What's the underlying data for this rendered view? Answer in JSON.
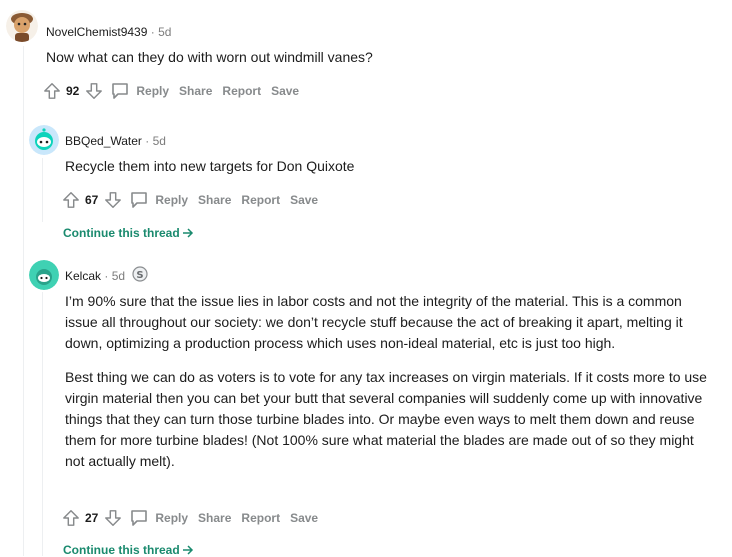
{
  "comments": [
    {
      "username": "NovelChemist9439",
      "age": "5d",
      "text": [
        "Now what can they do with worn out windmill vanes?"
      ],
      "votes": "92",
      "actions": {
        "reply": "Reply",
        "share": "Share",
        "report": "Report",
        "save": "Save"
      }
    },
    {
      "username": "BBQed_Water",
      "age": "5d",
      "text": [
        "Recycle them into new targets for Don Quixote"
      ],
      "votes": "67",
      "actions": {
        "reply": "Reply",
        "share": "Share",
        "report": "Report",
        "save": "Save"
      },
      "continue_label": "Continue this thread"
    },
    {
      "username": "Kelcak",
      "age": "5d",
      "award": "silver-award-icon",
      "text": [
        "I’m 90% sure that the issue lies in labor costs and not the integrity of the material. This is a common issue all throughout our society: we don’t recycle stuff because the act of breaking it apart, melting it down, optimizing a production process which uses non-ideal material, etc is just too high.",
        "Best thing we can do as voters is to vote for any tax increases on virgin materials. If it costs more to use virgin material then you can bet your butt that several companies will suddenly come up with innovative things that they can turn those turbine blades into. Or maybe even ways to melt them down and reuse them for more turbine blades! (Not 100% sure what material the blades are made out of so they might not actually melt)."
      ],
      "votes": "27",
      "actions": {
        "reply": "Reply",
        "share": "Share",
        "report": "Report",
        "save": "Save"
      },
      "continue_label": "Continue this thread"
    }
  ],
  "separator": "·",
  "colors": {
    "continue": "#1a8a6e",
    "meta": "#7c7c7c",
    "action": "#878a8c"
  }
}
